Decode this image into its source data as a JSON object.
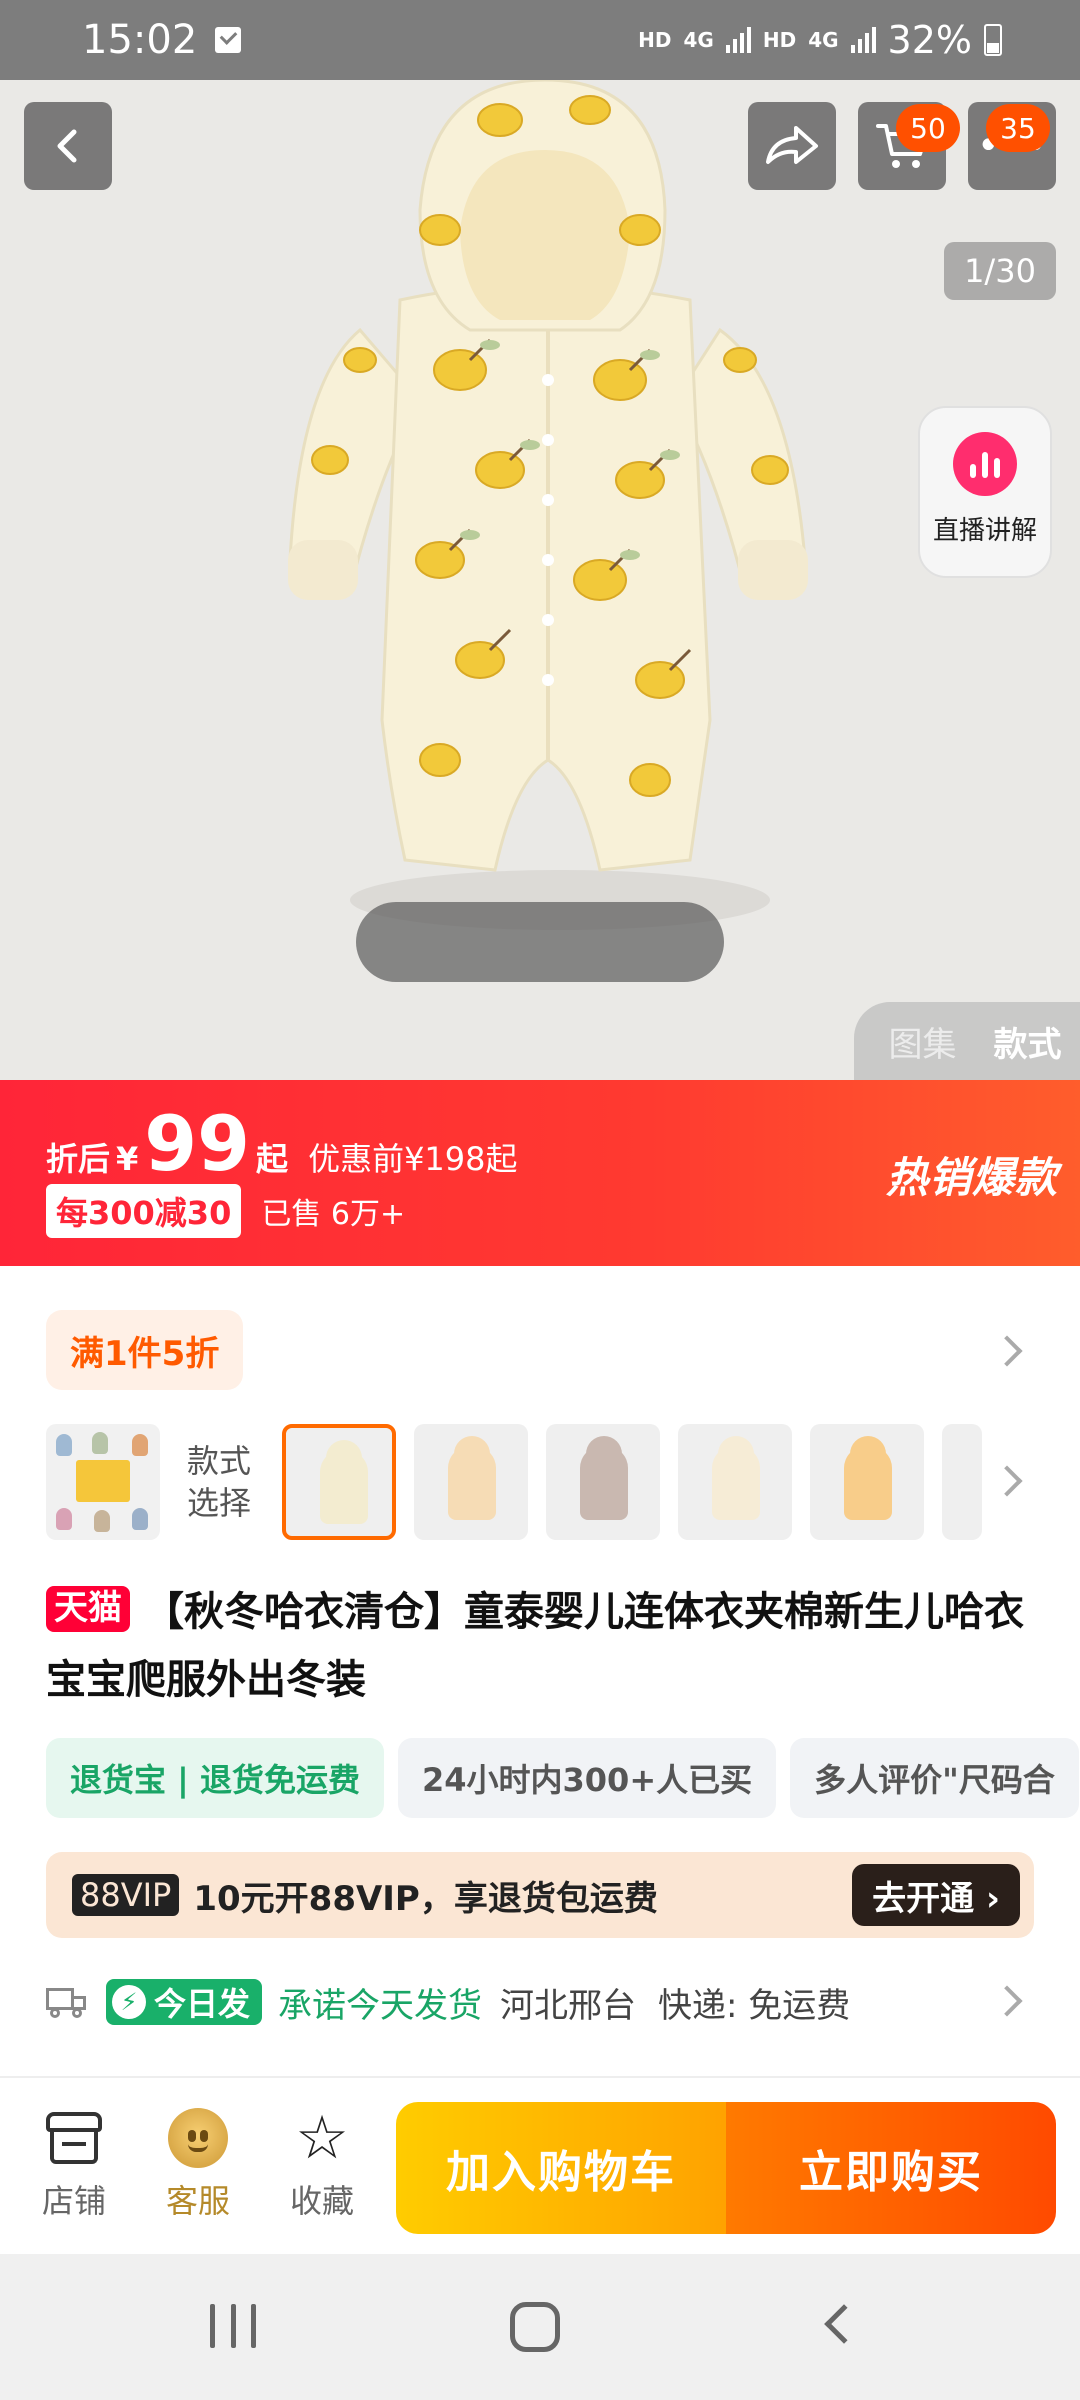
{
  "status_bar": {
    "time": "15:02",
    "network_1": "HD",
    "net_type_1": "4G",
    "network_2": "HD",
    "net_type_2": "4G",
    "battery": "32%"
  },
  "header": {
    "cart_badge": "50",
    "more_badge": "35",
    "page_indicator": "1/30"
  },
  "live": {
    "label": "直播讲解"
  },
  "gallery": {
    "tab_gallery": "图集",
    "tab_style": "款式"
  },
  "price_banner": {
    "prefix": "折后",
    "currency": "¥",
    "price": "99",
    "suffix": "起",
    "original_price": "优惠前¥198起",
    "coupon": "每300减30",
    "sold": "已售 6万+",
    "hot_label": "热销爆款"
  },
  "promo": {
    "label": "满1件5折"
  },
  "variants": {
    "label": "款式选择",
    "thumb_colors": [
      "#f3ecd0",
      "#f6dcb5",
      "#c9b8b0",
      "#f6ecd6",
      "#f8cd8a"
    ]
  },
  "product": {
    "store_badge": "天猫",
    "title": "【秋冬哈衣清仓】童泰婴儿连体衣夹棉新生儿哈衣宝宝爬服外出冬装"
  },
  "tags": [
    {
      "text": "退货宝 | 退货免运费",
      "style": "green"
    },
    {
      "text": "24小时内300+人已买",
      "style": "grey"
    },
    {
      "text": "多人评价\"尺码合",
      "style": "grey"
    }
  ],
  "vip": {
    "badge": "88VIP",
    "text": "10元开88VIP，享退货包运费",
    "button": "去开通 ›"
  },
  "shipping": {
    "today_badge": "今日发",
    "promise": "承诺今天发货",
    "origin": "河北邢台",
    "fee": "快递: 免运费"
  },
  "bottom_bar": {
    "store": "店铺",
    "service": "客服",
    "favorite": "收藏",
    "add_to_cart": "加入购物车",
    "buy_now": "立即购买"
  },
  "colors": {
    "accent_red": "#ff2538",
    "tmall_red": "#ff0036",
    "cart_yellow": "#ffa200",
    "buy_orange": "#ff4a00",
    "green": "#19a566"
  }
}
